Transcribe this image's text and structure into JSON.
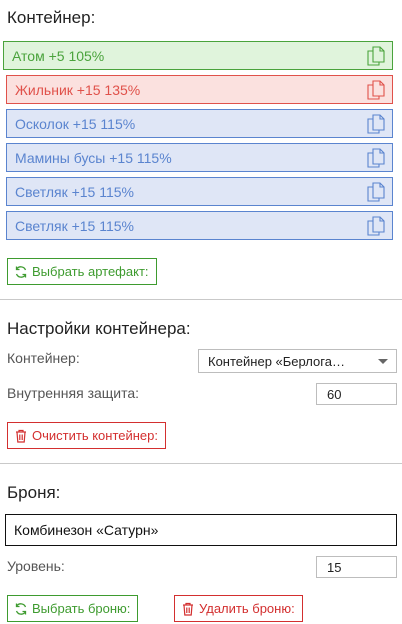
{
  "container": {
    "title": "Контейнер:",
    "artifacts": [
      {
        "label": "Атом +5 105%",
        "state": "green"
      },
      {
        "label": "Жильник +15 135%",
        "state": "red"
      },
      {
        "label": "Осколок +15 115%",
        "state": "blue"
      },
      {
        "label": "Мамины бусы +15 115%",
        "state": "blue"
      },
      {
        "label": "Светляк +15 115%",
        "state": "blue"
      },
      {
        "label": "Светляк +15 115%",
        "state": "blue"
      }
    ],
    "select_artifact_label": "Выбрать артефакт:"
  },
  "settings": {
    "title": "Настройки контейнера:",
    "container_label": "Контейнер:",
    "container_value": "Контейнер «Берлога…",
    "protection_label": "Внутренняя защита:",
    "protection_value": "60",
    "clear_label": "Очистить контейнер:"
  },
  "armor": {
    "title": "Броня:",
    "value": "Комбинезон «Сатурн»",
    "level_label": "Уровень:",
    "level_value": "15",
    "select_label": "Выбрать броню:",
    "delete_label": "Удалить броню:"
  },
  "colors": {
    "green": "#4aa33c",
    "red": "#e0514a",
    "blue": "#5a84cf"
  },
  "icons": {
    "copy": "copy-icon",
    "refresh": "refresh-icon",
    "trash": "trash-icon",
    "dropdown": "chevron-down-icon"
  }
}
